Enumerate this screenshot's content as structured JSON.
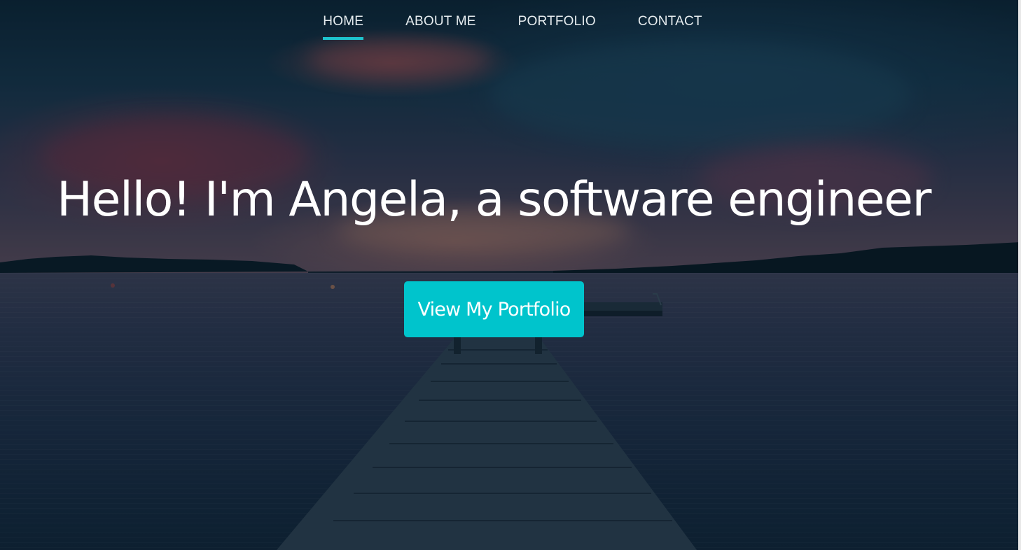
{
  "nav": {
    "items": [
      {
        "label": "HOME",
        "active": true
      },
      {
        "label": "ABOUT ME",
        "active": false
      },
      {
        "label": "PORTFOLIO",
        "active": false
      },
      {
        "label": "CONTACT",
        "active": false
      }
    ]
  },
  "hero": {
    "title": "Hello! I'm Angela, a software engineer",
    "cta_label": "View My Portfolio"
  },
  "colors": {
    "accent": "#00c4cc",
    "nav_underline": "#1ec3cd",
    "title_text": "#ffffff",
    "nav_text": "#e6ecef"
  },
  "background": {
    "image": "sunset lake with wooden pier"
  }
}
